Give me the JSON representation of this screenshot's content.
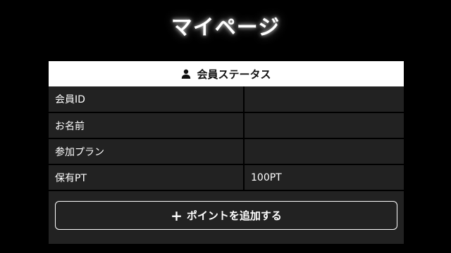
{
  "page_title": "マイページ",
  "status_card": {
    "header": "会員ステータス",
    "header_icon": "user-icon",
    "rows": [
      {
        "label": "会員ID",
        "value": ""
      },
      {
        "label": "お名前",
        "value": ""
      },
      {
        "label": "参加プラン",
        "value": ""
      },
      {
        "label": "保有PT",
        "value": "100PT"
      }
    ],
    "add_button": {
      "icon": "plus-icon",
      "label": "ポイントを追加する"
    }
  },
  "colors": {
    "background": "#000000",
    "card": "#222222",
    "header_bg": "#ffffff",
    "text": "#ffffff"
  }
}
